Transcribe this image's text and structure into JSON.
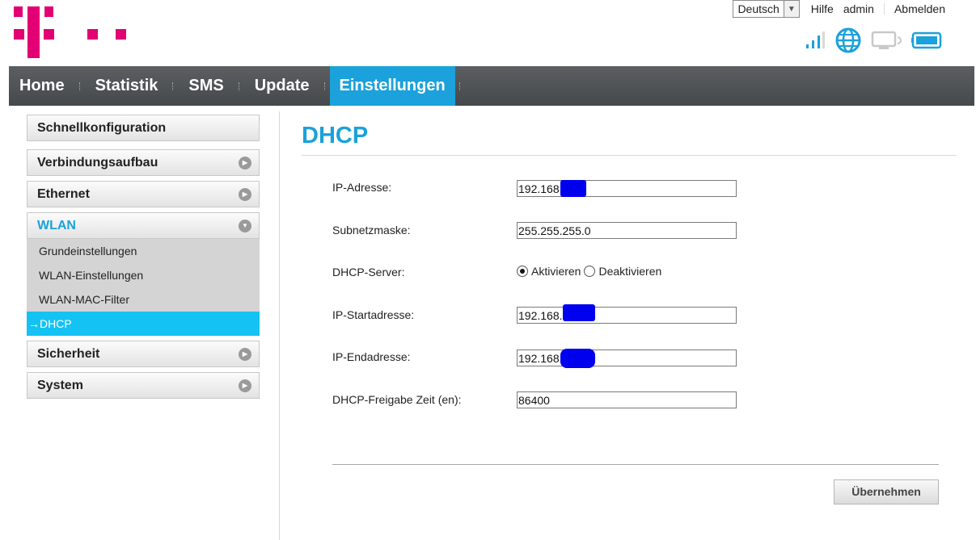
{
  "header": {
    "language": "Deutsch",
    "help_label": "Hilfe",
    "user_label": "admin",
    "logout_label": "Abmelden",
    "brand_color": "#e20074"
  },
  "status_icons": [
    "signal-strength-icon",
    "globe-icon",
    "device-icon",
    "battery-icon"
  ],
  "nav": {
    "items": [
      {
        "label": "Home"
      },
      {
        "label": "Statistik"
      },
      {
        "label": "SMS"
      },
      {
        "label": "Update"
      },
      {
        "label": "Einstellungen",
        "active": true
      }
    ],
    "accent_color": "#1ba1db"
  },
  "sidebar": {
    "quick_config": "Schnellkonfiguration",
    "connection": "Verbindungsaufbau",
    "ethernet": "Ethernet",
    "wlan": "WLAN",
    "wlan_sub": {
      "basic": "Grundeinstellungen",
      "wlan_settings": "WLAN-Einstellungen",
      "mac_filter": "WLAN-MAC-Filter",
      "dhcp": "→DHCP"
    },
    "security": "Sicherheit",
    "system": "System"
  },
  "page": {
    "title": "DHCP",
    "ip_label": "IP-Adresse:",
    "ip_value": "192.168.",
    "subnet_label": "Subnetzmaske:",
    "subnet_value": "255.255.255.0",
    "dhcp_server_label": "DHCP-Server:",
    "dhcp_enable": "Aktivieren",
    "dhcp_disable": "Deaktivieren",
    "dhcp_enabled": true,
    "start_label": "IP-Startadresse:",
    "start_value": "192.168.",
    "end_label": "IP-Endadresse:",
    "end_value": "192.168.",
    "lease_label": "DHCP-Freigabe Zeit (en):",
    "lease_value": "86400",
    "apply_label": "Übernehmen"
  }
}
